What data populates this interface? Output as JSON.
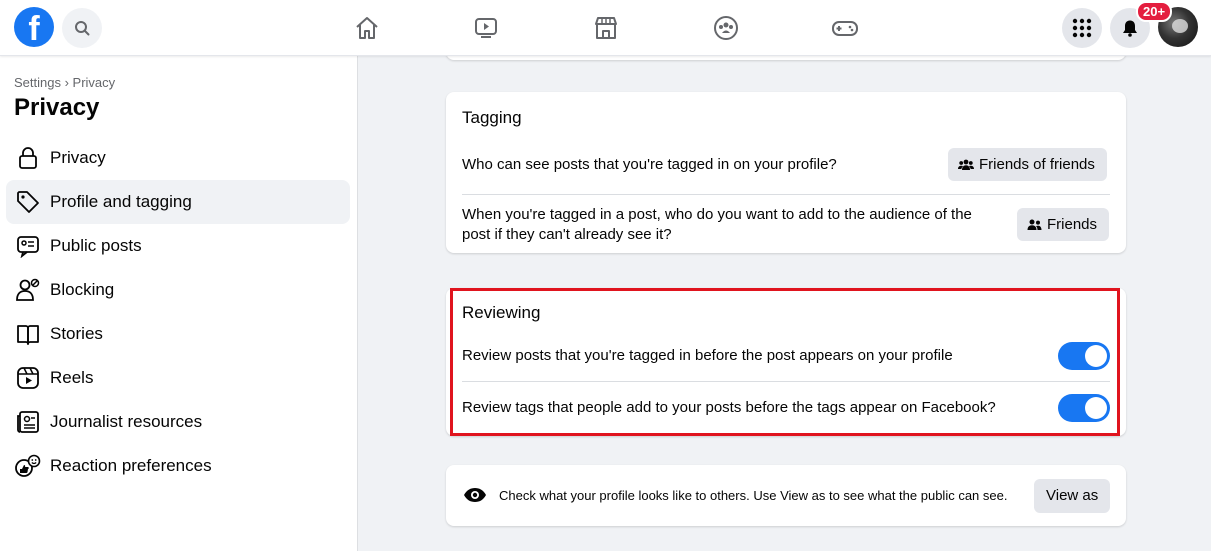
{
  "header": {
    "logo": "f",
    "nav_icons": [
      "home-icon",
      "watch-icon",
      "marketplace-icon",
      "groups-icon",
      "gaming-icon"
    ],
    "notification_badge": "20+"
  },
  "sidebar": {
    "breadcrumb": "Settings › Privacy",
    "title": "Privacy",
    "items": [
      {
        "label": "Privacy",
        "icon": "lock-icon"
      },
      {
        "label": "Profile and tagging",
        "icon": "tag-icon",
        "active": true
      },
      {
        "label": "Public posts",
        "icon": "public-posts-icon"
      },
      {
        "label": "Blocking",
        "icon": "blocking-icon"
      },
      {
        "label": "Stories",
        "icon": "stories-icon"
      },
      {
        "label": "Reels",
        "icon": "reels-icon"
      },
      {
        "label": "Journalist resources",
        "icon": "journalist-icon"
      },
      {
        "label": "Reaction preferences",
        "icon": "reaction-icon"
      }
    ]
  },
  "tagging": {
    "title": "Tagging",
    "row1_text": "Who can see posts that you're tagged in on your profile?",
    "row1_value": "Friends of friends",
    "row2_text_line1": "When you're tagged in a post, who do you want to add to the audience of the",
    "row2_text_line2": "post if they can't already see it?",
    "row2_value": "Friends"
  },
  "reviewing": {
    "title": "Reviewing",
    "row1_text": "Review posts that you're tagged in before the post appears on your profile",
    "row1_on": true,
    "row2_text": "Review tags that people add to your posts before the tags appear on Facebook?",
    "row2_on": true
  },
  "view_as": {
    "text": "Check what your profile looks like to others. Use View as to see what the public can see.",
    "button": "View as"
  },
  "colors": {
    "accent": "#1877f2",
    "highlight": "#e0141e",
    "badge": "#e41e3f"
  }
}
